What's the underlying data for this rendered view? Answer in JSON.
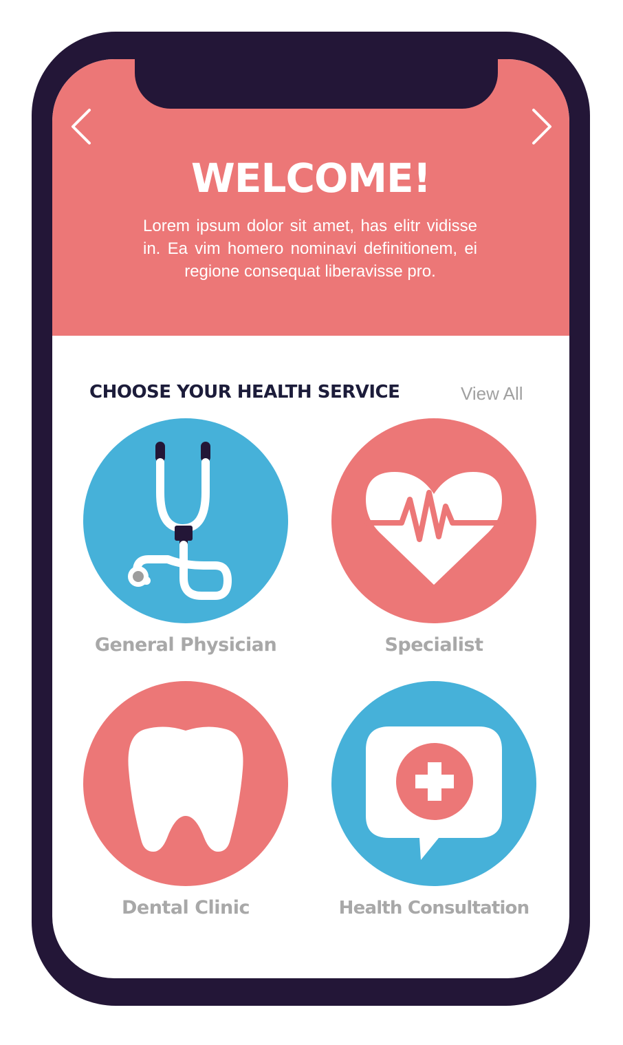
{
  "header": {
    "title": "WELCOME!",
    "description": "Lorem ipsum dolor sit amet, has elitr vidisse in. Ea vim homero nominavi definitionem, ei regione consequat liberavisse pro."
  },
  "navigation": {
    "prev_icon": "chevron-left-icon",
    "next_icon": "chevron-right-icon"
  },
  "services_section": {
    "title": "CHOOSE YOUR HEALTH SERVICE",
    "view_all_label": "View All",
    "items": [
      {
        "label": "General Physician",
        "icon": "stethoscope-icon",
        "color": "#46b1d9"
      },
      {
        "label": "Specialist",
        "icon": "heart-pulse-icon",
        "color": "#ec7777"
      },
      {
        "label": "Dental Clinic",
        "icon": "tooth-icon",
        "color": "#ec7777"
      },
      {
        "label": "Health Consultation",
        "icon": "medical-chat-icon",
        "color": "#46b1d9"
      }
    ]
  },
  "colors": {
    "phone_frame": "#231637",
    "accent_coral": "#ec7777",
    "accent_blue": "#46b1d9",
    "heading_dark": "#1c1c3a",
    "label_gray": "#a8a8a8",
    "view_all_gray": "#a0a0a0"
  }
}
